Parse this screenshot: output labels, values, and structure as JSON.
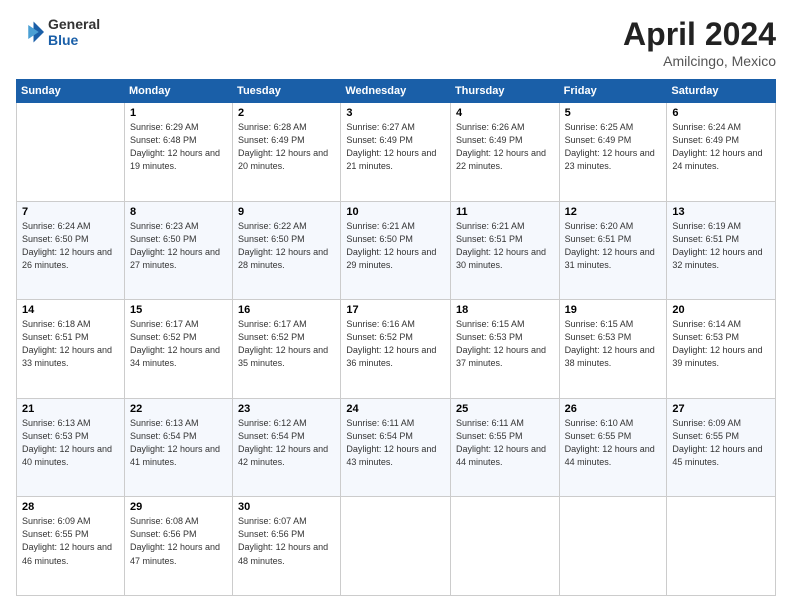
{
  "header": {
    "logo": {
      "general": "General",
      "blue": "Blue"
    },
    "title": "April 2024",
    "location": "Amilcingo, Mexico"
  },
  "days_of_week": [
    "Sunday",
    "Monday",
    "Tuesday",
    "Wednesday",
    "Thursday",
    "Friday",
    "Saturday"
  ],
  "weeks": [
    [
      null,
      {
        "day": 1,
        "sunrise": "6:29 AM",
        "sunset": "6:48 PM",
        "daylight": "12 hours and 19 minutes."
      },
      {
        "day": 2,
        "sunrise": "6:28 AM",
        "sunset": "6:49 PM",
        "daylight": "12 hours and 20 minutes."
      },
      {
        "day": 3,
        "sunrise": "6:27 AM",
        "sunset": "6:49 PM",
        "daylight": "12 hours and 21 minutes."
      },
      {
        "day": 4,
        "sunrise": "6:26 AM",
        "sunset": "6:49 PM",
        "daylight": "12 hours and 22 minutes."
      },
      {
        "day": 5,
        "sunrise": "6:25 AM",
        "sunset": "6:49 PM",
        "daylight": "12 hours and 23 minutes."
      },
      {
        "day": 6,
        "sunrise": "6:24 AM",
        "sunset": "6:49 PM",
        "daylight": "12 hours and 24 minutes."
      }
    ],
    [
      {
        "day": 7,
        "sunrise": "6:24 AM",
        "sunset": "6:50 PM",
        "daylight": "12 hours and 26 minutes."
      },
      {
        "day": 8,
        "sunrise": "6:23 AM",
        "sunset": "6:50 PM",
        "daylight": "12 hours and 27 minutes."
      },
      {
        "day": 9,
        "sunrise": "6:22 AM",
        "sunset": "6:50 PM",
        "daylight": "12 hours and 28 minutes."
      },
      {
        "day": 10,
        "sunrise": "6:21 AM",
        "sunset": "6:50 PM",
        "daylight": "12 hours and 29 minutes."
      },
      {
        "day": 11,
        "sunrise": "6:21 AM",
        "sunset": "6:51 PM",
        "daylight": "12 hours and 30 minutes."
      },
      {
        "day": 12,
        "sunrise": "6:20 AM",
        "sunset": "6:51 PM",
        "daylight": "12 hours and 31 minutes."
      },
      {
        "day": 13,
        "sunrise": "6:19 AM",
        "sunset": "6:51 PM",
        "daylight": "12 hours and 32 minutes."
      }
    ],
    [
      {
        "day": 14,
        "sunrise": "6:18 AM",
        "sunset": "6:51 PM",
        "daylight": "12 hours and 33 minutes."
      },
      {
        "day": 15,
        "sunrise": "6:17 AM",
        "sunset": "6:52 PM",
        "daylight": "12 hours and 34 minutes."
      },
      {
        "day": 16,
        "sunrise": "6:17 AM",
        "sunset": "6:52 PM",
        "daylight": "12 hours and 35 minutes."
      },
      {
        "day": 17,
        "sunrise": "6:16 AM",
        "sunset": "6:52 PM",
        "daylight": "12 hours and 36 minutes."
      },
      {
        "day": 18,
        "sunrise": "6:15 AM",
        "sunset": "6:53 PM",
        "daylight": "12 hours and 37 minutes."
      },
      {
        "day": 19,
        "sunrise": "6:15 AM",
        "sunset": "6:53 PM",
        "daylight": "12 hours and 38 minutes."
      },
      {
        "day": 20,
        "sunrise": "6:14 AM",
        "sunset": "6:53 PM",
        "daylight": "12 hours and 39 minutes."
      }
    ],
    [
      {
        "day": 21,
        "sunrise": "6:13 AM",
        "sunset": "6:53 PM",
        "daylight": "12 hours and 40 minutes."
      },
      {
        "day": 22,
        "sunrise": "6:13 AM",
        "sunset": "6:54 PM",
        "daylight": "12 hours and 41 minutes."
      },
      {
        "day": 23,
        "sunrise": "6:12 AM",
        "sunset": "6:54 PM",
        "daylight": "12 hours and 42 minutes."
      },
      {
        "day": 24,
        "sunrise": "6:11 AM",
        "sunset": "6:54 PM",
        "daylight": "12 hours and 43 minutes."
      },
      {
        "day": 25,
        "sunrise": "6:11 AM",
        "sunset": "6:55 PM",
        "daylight": "12 hours and 44 minutes."
      },
      {
        "day": 26,
        "sunrise": "6:10 AM",
        "sunset": "6:55 PM",
        "daylight": "12 hours and 44 minutes."
      },
      {
        "day": 27,
        "sunrise": "6:09 AM",
        "sunset": "6:55 PM",
        "daylight": "12 hours and 45 minutes."
      }
    ],
    [
      {
        "day": 28,
        "sunrise": "6:09 AM",
        "sunset": "6:55 PM",
        "daylight": "12 hours and 46 minutes."
      },
      {
        "day": 29,
        "sunrise": "6:08 AM",
        "sunset": "6:56 PM",
        "daylight": "12 hours and 47 minutes."
      },
      {
        "day": 30,
        "sunrise": "6:07 AM",
        "sunset": "6:56 PM",
        "daylight": "12 hours and 48 minutes."
      },
      null,
      null,
      null,
      null
    ]
  ]
}
